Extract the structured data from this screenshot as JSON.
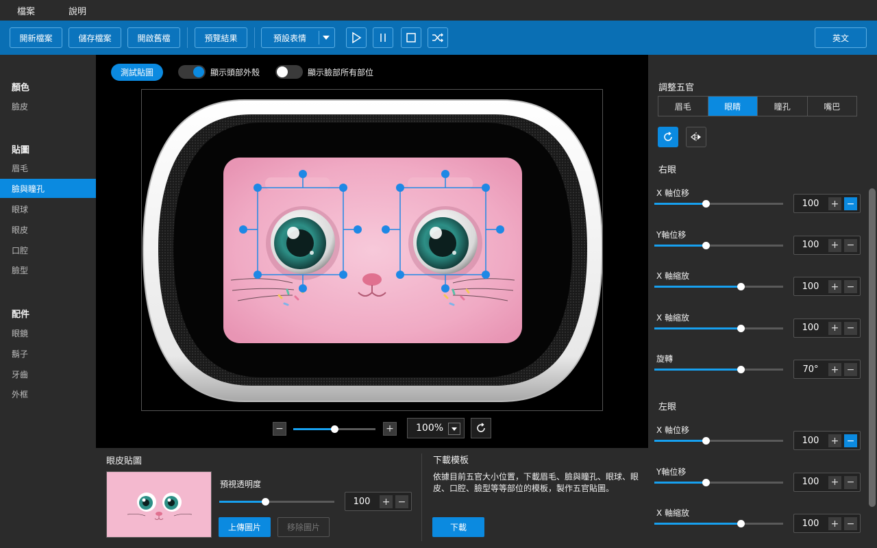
{
  "menu": {
    "file": "檔案",
    "help": "說明"
  },
  "toolbar": {
    "new_file": "開新檔案",
    "save_file": "儲存檔案",
    "open_old": "開啟舊檔",
    "preview": "預覽結果",
    "preset_expression": "預設表情",
    "language": "英文"
  },
  "sidebar": {
    "color_title": "顏色",
    "color_items": [
      "臉皮"
    ],
    "sticker_title": "貼圖",
    "sticker_items": [
      "眉毛",
      "臉與瞳孔",
      "眼球",
      "眼皮",
      "口腔",
      "臉型"
    ],
    "sticker_active": "臉與瞳孔",
    "accessory_title": "配件",
    "accessory_items": [
      "眼鏡",
      "鬍子",
      "牙齒",
      "外框"
    ]
  },
  "center": {
    "test_button": "測試貼圖",
    "toggle_shell_label": "顯示頭部外殼",
    "toggle_shell_on": true,
    "toggle_all_label": "顯示臉部所有部位",
    "toggle_all_on": false,
    "zoom_value": "100%",
    "zoom_slider": 0.5
  },
  "bottom": {
    "eyelid_title": "眼皮貼圖",
    "opacity_label": "預視透明度",
    "opacity_value": "100",
    "opacity_slider": 0.4,
    "upload_button": "上傳圖片",
    "remove_button": "移除圖片",
    "template_title": "下載模板",
    "template_desc": "依據目前五官大小位置，下載眉毛、臉與瞳孔、眼球、眼皮、口腔、臉型等等部位的模板，製作五官貼圖。",
    "download_button": "下載"
  },
  "right": {
    "title": "調整五官",
    "tabs": [
      "眉毛",
      "眼睛",
      "瞳孔",
      "嘴巴"
    ],
    "active_tab": "眼睛",
    "right_eye_title": "右眼",
    "right_eye_params": [
      {
        "label": "X 軸位移",
        "value": "100",
        "slider": 0.4
      },
      {
        "label": "Y軸位移",
        "value": "100",
        "slider": 0.4
      },
      {
        "label": "X 軸縮放",
        "value": "100",
        "slider": 0.67
      },
      {
        "label": "X 軸縮放",
        "value": "100",
        "slider": 0.67
      },
      {
        "label": "旋轉",
        "value": "70°",
        "slider": 0.67
      }
    ],
    "left_eye_title": "左眼",
    "left_eye_params": [
      {
        "label": "X 軸位移",
        "value": "100",
        "slider": 0.4
      },
      {
        "label": "Y軸位移",
        "value": "100",
        "slider": 0.4
      },
      {
        "label": "X 軸縮放",
        "value": "100",
        "slider": 0.67
      }
    ]
  },
  "colors": {
    "accent": "#0b8ae0",
    "toolbar": "#0a6fb4",
    "panel": "#2b2b2b",
    "stage": "#000000",
    "face_pink": "#f2b3cb"
  },
  "icons": [
    "play-icon",
    "pause-icon",
    "stop-icon",
    "shuffle-icon",
    "rotate-icon",
    "flip-icon",
    "reset-zoom-icon"
  ]
}
